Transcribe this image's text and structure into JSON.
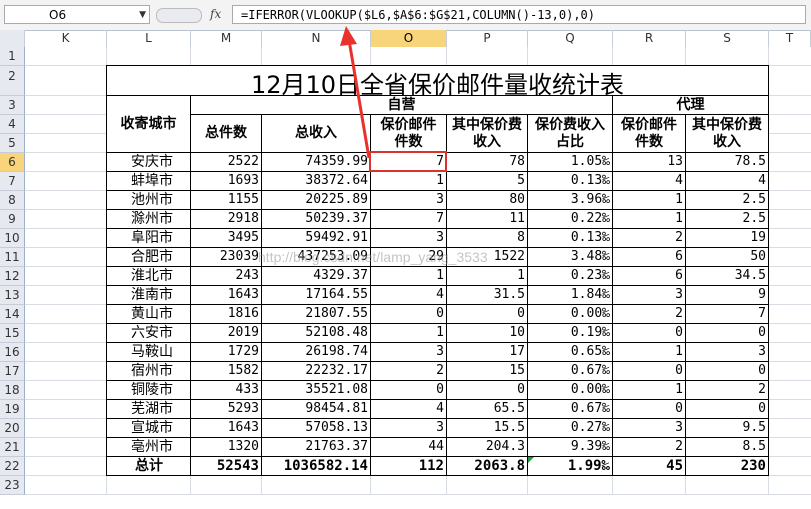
{
  "formula_bar": {
    "name_box": "O6",
    "fx_label": "fx",
    "formula": "=IFERROR(VLOOKUP($L6,$A$6:$G$21,COLUMN()-13,0),0)"
  },
  "columns": [
    "K",
    "L",
    "M",
    "N",
    "O",
    "P",
    "Q",
    "R",
    "S",
    "T"
  ],
  "selected_column": "O",
  "rows": [
    "1",
    "2",
    "3",
    "4",
    "5",
    "6",
    "7",
    "8",
    "9",
    "10",
    "11",
    "12",
    "13",
    "14",
    "15",
    "16",
    "17",
    "18",
    "19",
    "20",
    "21",
    "22",
    "23"
  ],
  "selected_row": "6",
  "watermark": "http://blog.csdn.net/lamp_yang_3533",
  "sheet": {
    "title": "12月10日全省保价邮件量收统计表",
    "city_header": "收寄城市",
    "group_self": "自营",
    "group_agent": "代理",
    "headers": [
      "总件数",
      "总收入",
      "保价邮件件数",
      "其中保价费收入",
      "保价费收入占比",
      "保价邮件件数",
      "其中保价费收入"
    ],
    "data": [
      [
        "安庆市",
        "2522",
        "74359.99",
        "7",
        "78",
        "1.05‰",
        "13",
        "78.5"
      ],
      [
        "蚌埠市",
        "1693",
        "38372.64",
        "1",
        "5",
        "0.13‰",
        "4",
        "4"
      ],
      [
        "池州市",
        "1155",
        "20225.89",
        "3",
        "80",
        "3.96‰",
        "1",
        "2.5"
      ],
      [
        "滁州市",
        "2918",
        "50239.37",
        "7",
        "11",
        "0.22‰",
        "1",
        "2.5"
      ],
      [
        "阜阳市",
        "3495",
        "59492.91",
        "3",
        "8",
        "0.13‰",
        "2",
        "19"
      ],
      [
        "合肥市",
        "23039",
        "437253.09",
        "29",
        "1522",
        "3.48‰",
        "6",
        "50"
      ],
      [
        "淮北市",
        "243",
        "4329.37",
        "1",
        "1",
        "0.23‰",
        "6",
        "34.5"
      ],
      [
        "淮南市",
        "1643",
        "17164.55",
        "4",
        "31.5",
        "1.84‰",
        "3",
        "9"
      ],
      [
        "黄山市",
        "1816",
        "21807.55",
        "0",
        "0",
        "0.00‰",
        "2",
        "7"
      ],
      [
        "六安市",
        "2019",
        "52108.48",
        "1",
        "10",
        "0.19‰",
        "0",
        "0"
      ],
      [
        "马鞍山",
        "1729",
        "26198.74",
        "3",
        "17",
        "0.65‰",
        "1",
        "3"
      ],
      [
        "宿州市",
        "1582",
        "22232.17",
        "2",
        "15",
        "0.67‰",
        "0",
        "0"
      ],
      [
        "铜陵市",
        "433",
        "35521.08",
        "0",
        "0",
        "0.00‰",
        "1",
        "2"
      ],
      [
        "芜湖市",
        "5293",
        "98454.81",
        "4",
        "65.5",
        "0.67‰",
        "0",
        "0"
      ],
      [
        "宣城市",
        "1643",
        "57058.13",
        "3",
        "15.5",
        "0.27‰",
        "3",
        "9.5"
      ],
      [
        "亳州市",
        "1320",
        "21763.37",
        "44",
        "204.3",
        "9.39‰",
        "2",
        "8.5"
      ]
    ],
    "total": [
      "总计",
      "52543",
      "1036582.14",
      "112",
      "2063.8",
      "1.99‰",
      "45",
      "230"
    ]
  },
  "colors": {
    "selection": "#f8d47a",
    "active_cell_border": "#d9332b",
    "arrow": "#e8322b"
  }
}
